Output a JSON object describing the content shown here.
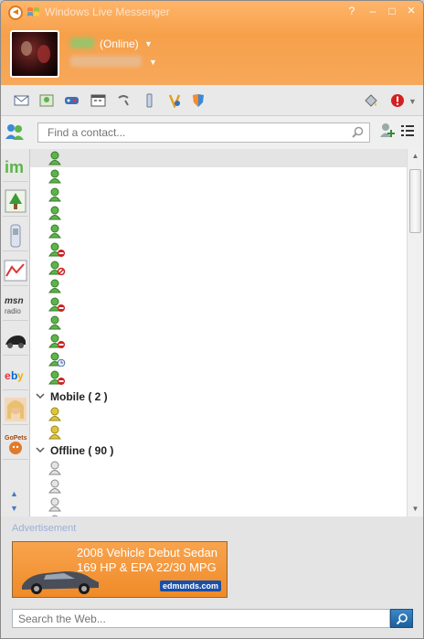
{
  "window": {
    "title": "Windows Live Messenger",
    "buttons": {
      "help": "?",
      "minimize": "–",
      "maximize": "□",
      "close": "×"
    }
  },
  "profile": {
    "status": "(Online)"
  },
  "toolbar": {
    "icons": [
      "mail-icon",
      "contacts-icon",
      "games-icon",
      "calendar-icon",
      "phone-icon",
      "mobile-icon",
      "wallpaper-icon",
      "shield-icon",
      "paint-bucket-icon",
      "alert-icon"
    ]
  },
  "contact_search": {
    "placeholder": "Find a contact..."
  },
  "groups": [
    {
      "label": "Mobile ( 2 )"
    },
    {
      "label": "Offline ( 90 )"
    }
  ],
  "advertisement": {
    "label": "Advertisement",
    "headline": "2008 Vehicle Debut Sedan",
    "subline": "169 HP & EPA 22/30 MPG",
    "brand": "edmunds.com"
  },
  "web_search": {
    "placeholder": "Search the Web..."
  },
  "colors": {
    "header": "#f6a04a",
    "online": "#5bb54a",
    "mobile": "#e0c43a",
    "offline": "#a8a8a8",
    "blocked": "#cc2222"
  }
}
